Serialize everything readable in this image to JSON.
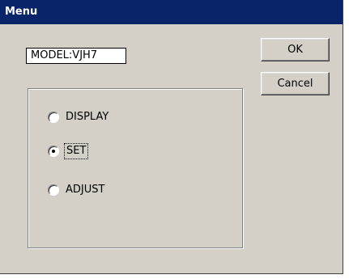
{
  "window": {
    "title": "Menu"
  },
  "model": {
    "text": "MODEL:VJH7"
  },
  "buttons": {
    "ok_label": "OK",
    "cancel_label": "Cancel"
  },
  "options": [
    {
      "label": "DISPLAY",
      "selected": false
    },
    {
      "label": "SET",
      "selected": true
    },
    {
      "label": "ADJUST",
      "selected": false
    }
  ],
  "colors": {
    "title_bar": "#0a246a",
    "face": "#d4d0c8"
  }
}
